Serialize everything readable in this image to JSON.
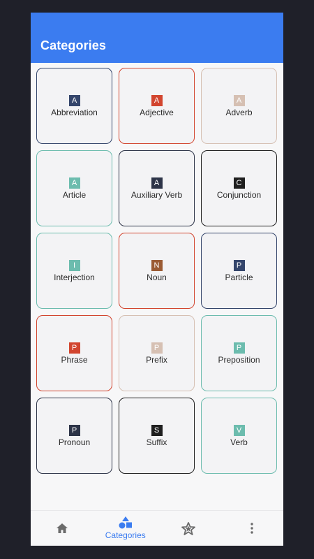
{
  "appbar": {
    "title": "Categories"
  },
  "categories": [
    {
      "letter": "A",
      "label": "Abbreviation",
      "badge_color": "#34456b",
      "border_color": "#34456b"
    },
    {
      "letter": "A",
      "label": "Adjective",
      "badge_color": "#d2452f",
      "border_color": "#d2452f"
    },
    {
      "letter": "A",
      "label": "Adverb",
      "badge_color": "#d6c0b3",
      "border_color": "#d6c0b3"
    },
    {
      "letter": "A",
      "label": "Article",
      "badge_color": "#6cbcae",
      "border_color": "#6cbcae"
    },
    {
      "letter": "A",
      "label": "Auxiliary Verb",
      "badge_color": "#2d3448",
      "border_color": "#2d3448"
    },
    {
      "letter": "C",
      "label": "Conjunction",
      "badge_color": "#1f1f1f",
      "border_color": "#1f1f1f"
    },
    {
      "letter": "I",
      "label": "Interjection",
      "badge_color": "#6cbcae",
      "border_color": "#6cbcae"
    },
    {
      "letter": "N",
      "label": "Noun",
      "badge_color": "#9b5b34",
      "border_color": "#d2452f"
    },
    {
      "letter": "P",
      "label": "Particle",
      "badge_color": "#34456b",
      "border_color": "#34456b"
    },
    {
      "letter": "P",
      "label": "Phrase",
      "badge_color": "#d2452f",
      "border_color": "#d2452f"
    },
    {
      "letter": "P",
      "label": "Prefix",
      "badge_color": "#d6c0b3",
      "border_color": "#d6c0b3"
    },
    {
      "letter": "P",
      "label": "Preposition",
      "badge_color": "#6cbcae",
      "border_color": "#6cbcae"
    },
    {
      "letter": "P",
      "label": "Pronoun",
      "badge_color": "#2d3448",
      "border_color": "#2d3448"
    },
    {
      "letter": "S",
      "label": "Suffix",
      "badge_color": "#1f1f1f",
      "border_color": "#1f1f1f"
    },
    {
      "letter": "V",
      "label": "Verb",
      "badge_color": "#6cbcae",
      "border_color": "#6cbcae"
    }
  ],
  "bottom_nav": {
    "items": [
      {
        "icon": "home-icon",
        "label": "",
        "active": false
      },
      {
        "icon": "shapes-icon",
        "label": "Categories",
        "active": true
      },
      {
        "icon": "star-icon",
        "label": "",
        "active": false
      },
      {
        "icon": "more-vertical-icon",
        "label": "",
        "active": false
      }
    ]
  },
  "colors": {
    "primary": "#3b7cf0",
    "inactive_icon": "#6b6b6b"
  }
}
